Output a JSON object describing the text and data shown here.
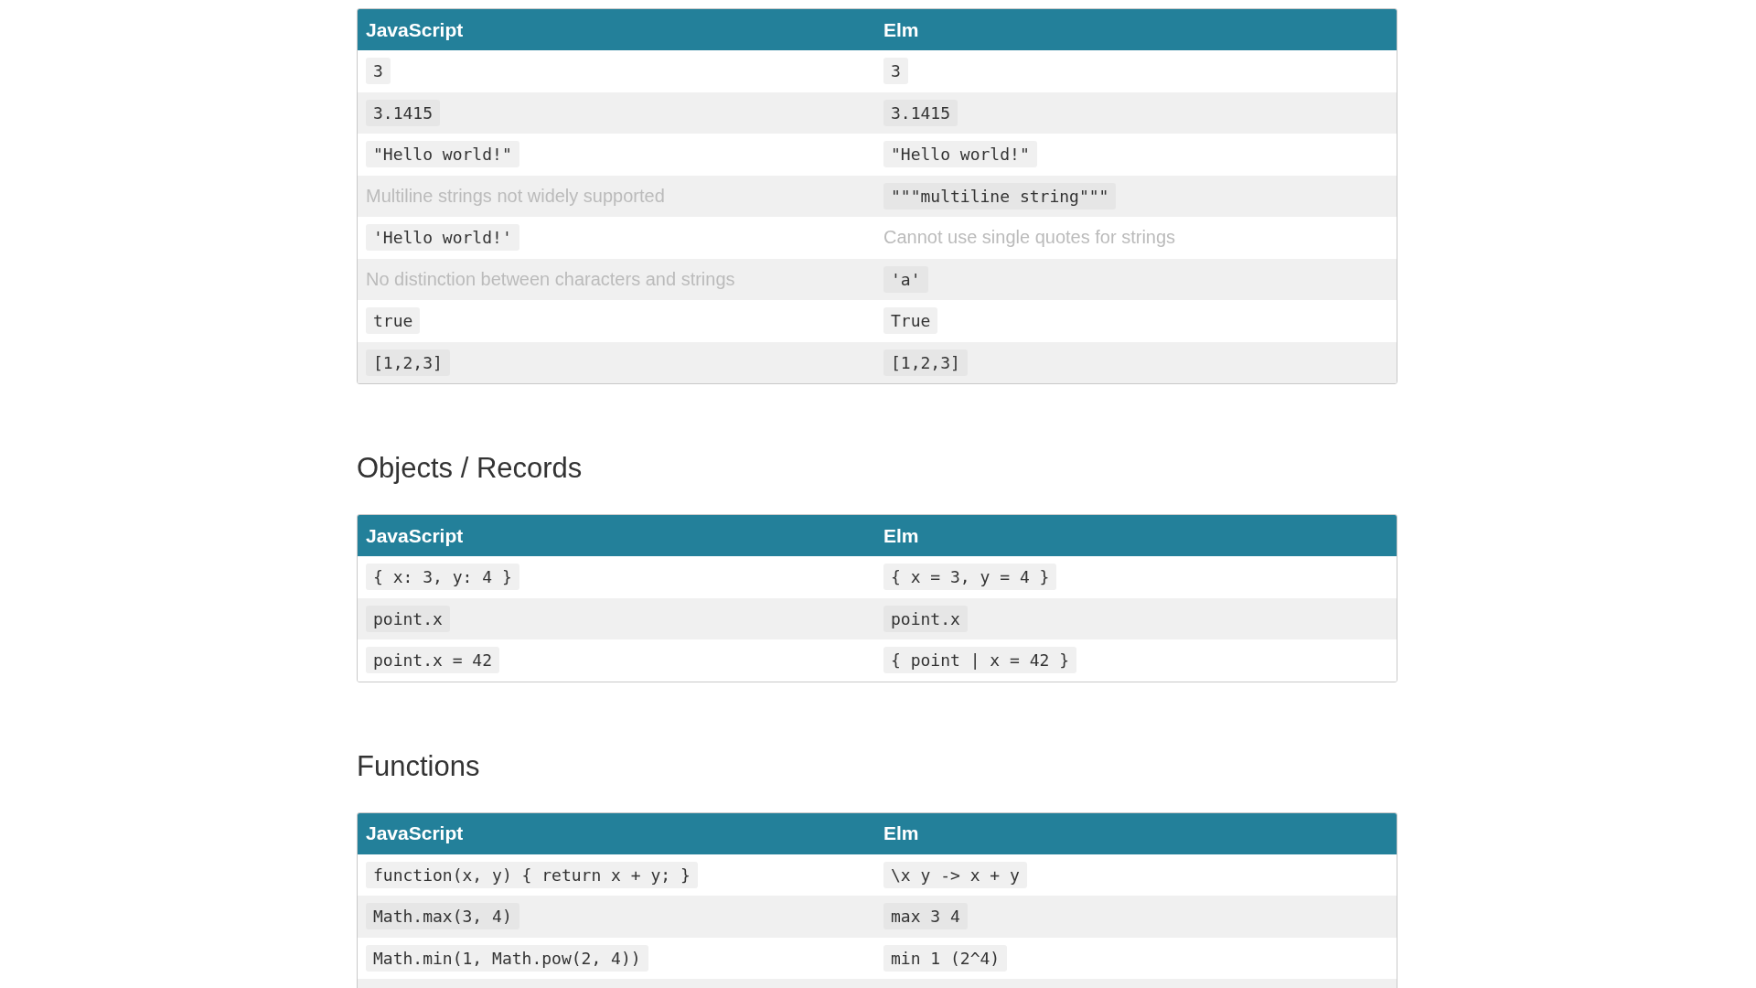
{
  "sections": [
    {
      "columns": [
        "JavaScript",
        "Elm"
      ],
      "rows": [
        [
          {
            "kind": "code",
            "text": "3"
          },
          {
            "kind": "code",
            "text": "3"
          }
        ],
        [
          {
            "kind": "code",
            "text": "3.1415"
          },
          {
            "kind": "code",
            "text": "3.1415"
          }
        ],
        [
          {
            "kind": "code",
            "text": "\"Hello world!\""
          },
          {
            "kind": "code",
            "text": "\"Hello world!\""
          }
        ],
        [
          {
            "kind": "note",
            "text": "Multiline strings not widely supported"
          },
          {
            "kind": "code",
            "text": "\"\"\"multiline string\"\"\""
          }
        ],
        [
          {
            "kind": "code",
            "text": "'Hello world!'"
          },
          {
            "kind": "note",
            "text": "Cannot use single quotes for strings"
          }
        ],
        [
          {
            "kind": "note",
            "text": "No distinction between characters and strings"
          },
          {
            "kind": "code",
            "text": "'a'"
          }
        ],
        [
          {
            "kind": "code",
            "text": "true"
          },
          {
            "kind": "code",
            "text": "True"
          }
        ],
        [
          {
            "kind": "code",
            "text": "[1,2,3]"
          },
          {
            "kind": "code",
            "text": "[1,2,3]"
          }
        ]
      ]
    },
    {
      "heading": "Objects / Records",
      "columns": [
        "JavaScript",
        "Elm"
      ],
      "rows": [
        [
          {
            "kind": "code",
            "text": "{ x: 3, y: 4 }"
          },
          {
            "kind": "code",
            "text": "{ x = 3, y = 4 }"
          }
        ],
        [
          {
            "kind": "code",
            "text": "point.x"
          },
          {
            "kind": "code",
            "text": "point.x"
          }
        ],
        [
          {
            "kind": "code",
            "text": "point.x = 42"
          },
          {
            "kind": "code",
            "text": "{ point | x = 42 }"
          }
        ]
      ]
    },
    {
      "heading": "Functions",
      "columns": [
        "JavaScript",
        "Elm"
      ],
      "rows": [
        [
          {
            "kind": "code",
            "text": "function(x, y) { return x + y; }"
          },
          {
            "kind": "code",
            "text": "\\x y -> x + y"
          }
        ],
        [
          {
            "kind": "code",
            "text": "Math.max(3, 4)"
          },
          {
            "kind": "code",
            "text": "max 3 4"
          }
        ],
        [
          {
            "kind": "code",
            "text": "Math.min(1, Math.pow(2, 4))"
          },
          {
            "kind": "code",
            "text": "min 1 (2^4)"
          }
        ]
      ]
    }
  ]
}
